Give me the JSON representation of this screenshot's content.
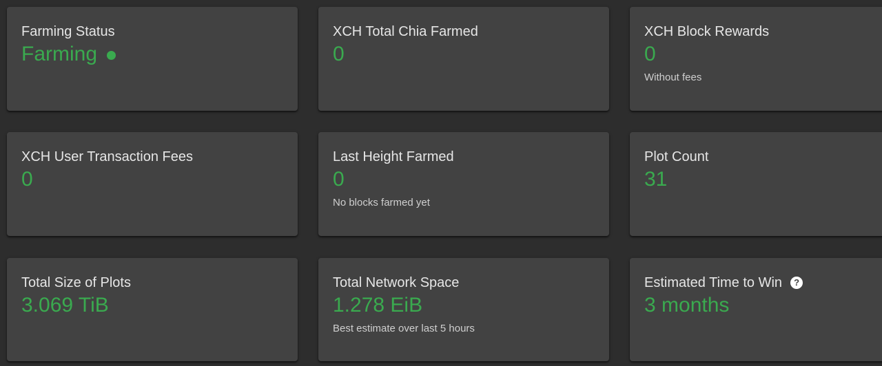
{
  "colors": {
    "background": "#2d2d2d",
    "card": "#424242",
    "accent_green": "#3aaa4f",
    "title_text": "#e6e6e6"
  },
  "cards": {
    "farming_status": {
      "title": "Farming Status",
      "value": "Farming",
      "indicator_icon": "status-dot-icon"
    },
    "total_chia_farmed": {
      "title": "XCH Total Chia Farmed",
      "value": "0"
    },
    "block_rewards": {
      "title": "XCH Block Rewards",
      "value": "0",
      "description": "Without fees"
    },
    "user_transaction_fees": {
      "title": "XCH User Transaction Fees",
      "value": "0"
    },
    "last_height_farmed": {
      "title": "Last Height Farmed",
      "value": "0",
      "description": "No blocks farmed yet"
    },
    "plot_count": {
      "title": "Plot Count",
      "value": "31"
    },
    "total_size_of_plots": {
      "title": "Total Size of Plots",
      "value": "3.069 TiB"
    },
    "total_network_space": {
      "title": "Total Network Space",
      "value": "1.278 EiB",
      "description": "Best estimate over last 5 hours"
    },
    "estimated_time_to_win": {
      "title": "Estimated Time to Win",
      "value": "3 months",
      "help_icon": "question-circle-icon",
      "help_glyph": "?"
    }
  }
}
